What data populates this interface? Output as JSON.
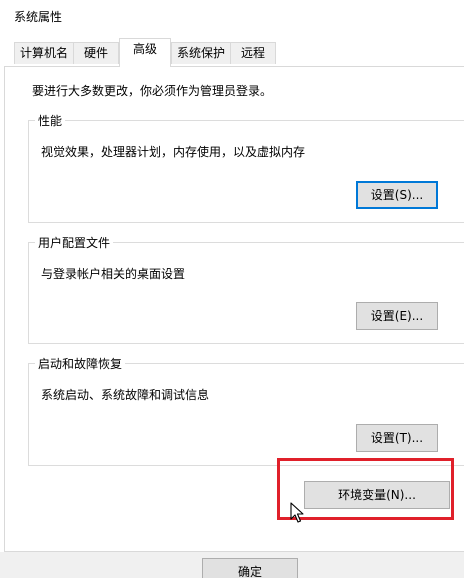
{
  "window": {
    "title": "系统属性"
  },
  "tabs": [
    {
      "label": "计算机名"
    },
    {
      "label": "硬件"
    },
    {
      "label": "高级",
      "active": true
    },
    {
      "label": "系统保护"
    },
    {
      "label": "远程"
    }
  ],
  "notice": "要进行大多数更改，你必须作为管理员登录。",
  "groups": {
    "performance": {
      "title": "性能",
      "description": "视觉效果，处理器计划，内存使用，以及虚拟内存",
      "button": "设置(S)..."
    },
    "user_profiles": {
      "title": "用户配置文件",
      "description": "与登录帐户相关的桌面设置",
      "button": "设置(E)..."
    },
    "startup_recovery": {
      "title": "启动和故障恢复",
      "description": "系统启动、系统故障和调试信息",
      "button": "设置(T)..."
    }
  },
  "env_button": "环境变量(N)...",
  "ok_button": "确定",
  "colors": {
    "highlight": "#e0202a",
    "focus": "#0078d7"
  },
  "icons": {
    "cursor": "mouse-pointer-icon"
  }
}
